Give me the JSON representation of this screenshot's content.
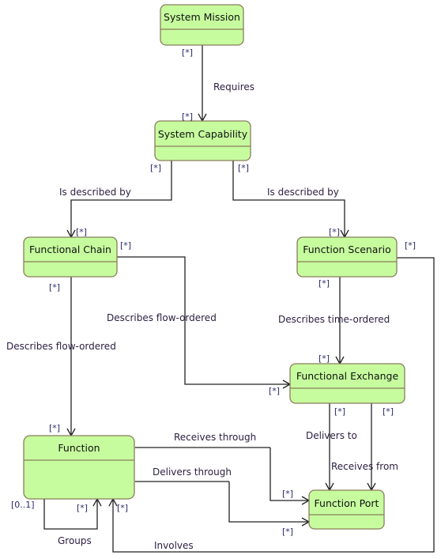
{
  "classes": {
    "system_mission": "System Mission",
    "system_capability": "System Capability",
    "functional_chain": "Functional Chain",
    "function_scenario": "Function Scenario",
    "functional_exchange": "Functional Exchange",
    "function": "Function",
    "function_port": "Function Port"
  },
  "relations": {
    "requires": "Requires",
    "cap_chain": "Is described by",
    "cap_scenario": "Is described by",
    "chain_function": "Describes flow-ordered",
    "chain_exchange": "Describes flow-ordered",
    "scenario_exchange": "Describes time-ordered",
    "delivers_to": "Delivers to",
    "receives_from": "Receives from",
    "receives_through": "Receives through",
    "delivers_through": "Delivers through",
    "groups": "Groups",
    "involves": "Involves"
  },
  "multiplicities": {
    "many": "[*]",
    "zero_one": "[0..1]"
  },
  "colors": {
    "class_fill": "#c6fc9e",
    "class_border": "#8b7d5c"
  }
}
